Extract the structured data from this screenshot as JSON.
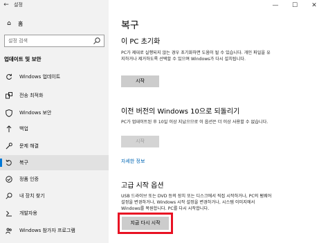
{
  "window": {
    "title": "설정",
    "minimize": "—",
    "maximize": "☐",
    "close": "✕"
  },
  "sidebar": {
    "home_label": "홈",
    "search_placeholder": "설정 검색",
    "section_title": "업데이트 및 보안",
    "items": [
      {
        "label": "Windows 업데이트",
        "icon": "sync-icon"
      },
      {
        "label": "전송 최적화",
        "icon": "delivery-optimization-icon"
      },
      {
        "label": "Windows 보안",
        "icon": "shield-icon"
      },
      {
        "label": "백업",
        "icon": "backup-icon"
      },
      {
        "label": "문제 해결",
        "icon": "wrench-icon"
      },
      {
        "label": "복구",
        "icon": "recovery-icon"
      },
      {
        "label": "정품 인증",
        "icon": "activation-icon"
      },
      {
        "label": "내 장치 찾기",
        "icon": "find-device-icon"
      },
      {
        "label": "개발자용",
        "icon": "developer-icon"
      },
      {
        "label": "Windows 참가자 프로그램",
        "icon": "insider-icon"
      }
    ],
    "active_index": 5
  },
  "main": {
    "title": "복구",
    "reset": {
      "heading": "이 PC 초기화",
      "text": "PC가 제대로 실행되지 않는 경우 초기화하면 도움이 될 수 있습니다. 개인 파일을 유지하거나 제거하도록 선택할 수 있으며 Windows가 다시 설치됩니다.",
      "button": "시작"
    },
    "go_back": {
      "heading": "이전 버전의 Windows 10으로 되돌리기",
      "text": "PC가 업데이트된 후 10일 이상 지났으므로 이 옵션은 더 이상 사용할 수 없습니다.",
      "button": "시작",
      "link": "자세한 정보"
    },
    "advanced": {
      "heading": "고급 시작 옵션",
      "text": "USB 드라이브 또는 DVD 등의 장치 또는 디스크에서 직접 시작하거나, PC의 펌웨어 설정을 변경하거나, Windows 시작 설정을 변경하거나, 시스템 이미지에서 Windows를 복원합니다. PC를 다시 시작합니다.",
      "button": "지금 다시 시작"
    }
  },
  "colors": {
    "accent": "#0078d7",
    "highlight": "#e81123",
    "link": "#0066b4"
  }
}
